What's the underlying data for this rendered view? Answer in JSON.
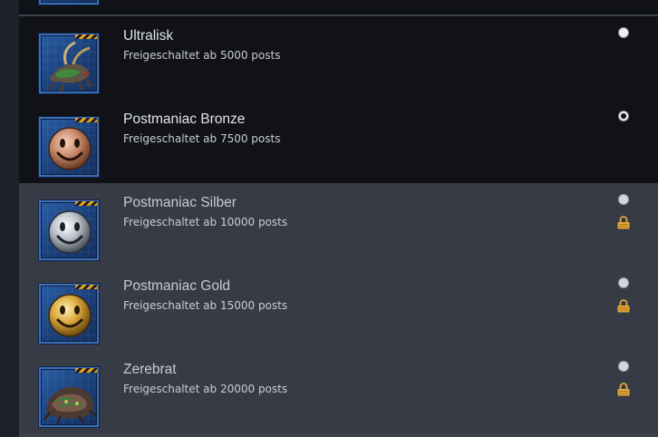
{
  "avatars": [
    {
      "name": "Ultralisk",
      "unlock_text": "Freigeschaltet ab 5000 posts",
      "selected": false,
      "locked": false,
      "icon": "ultralisk-icon"
    },
    {
      "name": "Postmaniac Bronze",
      "unlock_text": "Freigeschaltet ab 7500 posts",
      "selected": true,
      "locked": false,
      "icon": "smiley-bronze-icon"
    },
    {
      "name": "Postmaniac Silber",
      "unlock_text": "Freigeschaltet ab 10000 posts",
      "selected": false,
      "locked": true,
      "icon": "smiley-silver-icon"
    },
    {
      "name": "Postmaniac Gold",
      "unlock_text": "Freigeschaltet ab 15000 posts",
      "selected": false,
      "locked": true,
      "icon": "smiley-gold-icon"
    },
    {
      "name": "Zerebrat",
      "unlock_text": "Freigeschaltet ab 20000 posts",
      "selected": false,
      "locked": true,
      "icon": "zerebrat-icon"
    }
  ],
  "colors": {
    "unlocked_row_bg": "#101218",
    "locked_row_bg": "#363b46",
    "lock_icon": "#e2a83a"
  }
}
